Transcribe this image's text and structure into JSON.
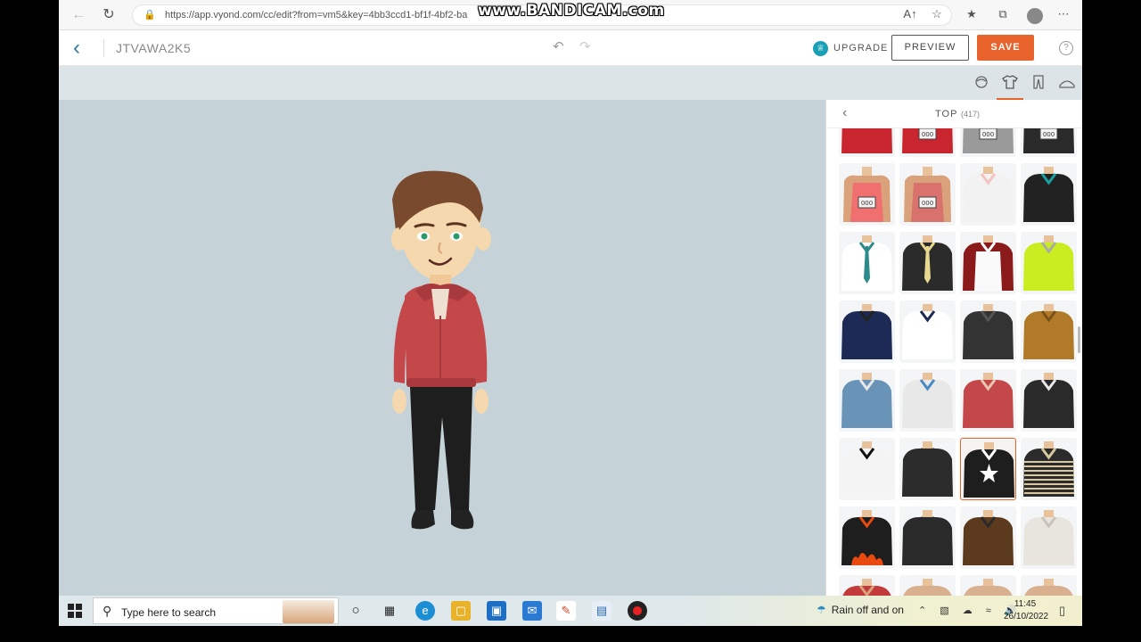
{
  "browser": {
    "url": "https://app.vyond.com/cc/edit?from=vm5&key=4bb3ccd1-bf1f-4bf2-ba",
    "watermark": "www.BANDICAM.com",
    "icons": [
      "back-icon",
      "refresh-icon",
      "lock-icon",
      "read-aloud-icon",
      "favorite-icon",
      "favorites-icon",
      "collections-icon",
      "profile-icon",
      "more-icon"
    ]
  },
  "header": {
    "project_title": "JTVAWA2K5",
    "upgrade_label": "UPGRADE",
    "preview_label": "PREVIEW",
    "save_label": "SAVE",
    "help_label": "?"
  },
  "category_tabs": [
    {
      "name": "head",
      "icon": "head-icon"
    },
    {
      "name": "top",
      "icon": "shirt-icon",
      "active": true
    },
    {
      "name": "bottom",
      "icon": "pants-icon"
    },
    {
      "name": "shoes",
      "icon": "shoe-icon"
    }
  ],
  "panel": {
    "title": "TOP",
    "count": "(417)",
    "selected_index": 22,
    "tiles": [
      {
        "top": "#c8252e",
        "trim": "#222"
      },
      {
        "top": "#c8252e",
        "trim": "#eee",
        "bib": true
      },
      {
        "top": "#9a9a9a",
        "trim": "#ddd",
        "bib": true
      },
      {
        "top": "#2a2a2a",
        "trim": "#ddd",
        "bib": true
      },
      {
        "top": "#f07070",
        "trim": "#d9a27a",
        "bib": true,
        "tank": true
      },
      {
        "top": "#d9716c",
        "trim": "#d9a27a",
        "bib": true,
        "tank": true
      },
      {
        "top": "#f2f2f2",
        "trim": "#f5c2c2"
      },
      {
        "top": "#222",
        "trim": "#1aa0a0"
      },
      {
        "top": "#ffffff",
        "trim": "#2c8a8a",
        "tie": true
      },
      {
        "top": "#2b2b2b",
        "trim": "#e8d890",
        "tie": true
      },
      {
        "top": "#8b1b1b",
        "trim": "#fff",
        "apron": true
      },
      {
        "top": "#c8ee22",
        "trim": "#aaa"
      },
      {
        "top": "#1c2a55",
        "trim": "#222"
      },
      {
        "top": "#ffffff",
        "trim": "#1c2a55"
      },
      {
        "top": "#333",
        "trim": "#555"
      },
      {
        "top": "#b07a28",
        "trim": "#7a5218"
      },
      {
        "top": "#6a93b8",
        "trim": "#e8e8e8"
      },
      {
        "top": "#e8e8e8",
        "trim": "#4a8ac0"
      },
      {
        "top": "#c4474a",
        "trim": "#e8c8b0"
      },
      {
        "top": "#2a2a2a",
        "trim": "#e8e8e8"
      },
      {
        "top": "#f4f4f4",
        "trim": "#111"
      },
      {
        "top": "#2c2c2c",
        "trim": "#2c2c2c"
      },
      {
        "top": "#1e1e1e",
        "trim": "#fff",
        "star": true
      },
      {
        "top": "#2b2b2b",
        "trim": "#d8c8a0",
        "stripes": true
      },
      {
        "top": "#1e1e1e",
        "trim": "#e84a10",
        "flames": true
      },
      {
        "top": "#2a2a2a",
        "trim": "#2a2a2a"
      },
      {
        "top": "#5c3a1e",
        "trim": "#2a2a2a"
      },
      {
        "top": "#e8e4de",
        "trim": "#c9c3b8"
      },
      {
        "top": "#c23a3a",
        "trim": "#d9a27a"
      },
      {
        "top": "#d8b090",
        "trim": "#d8b090"
      },
      {
        "top": "#d8b090",
        "trim": "#d8b090"
      },
      {
        "top": "#d8b090",
        "trim": "#d8b090"
      }
    ]
  },
  "character": {
    "hair": "#7a4a2e",
    "skin": "#f6d8ae",
    "jacket": "#c4474a",
    "pants": "#1e1e1e",
    "shoes": "#1e1e1e",
    "eyes": "#2a9a6a"
  },
  "taskbar": {
    "search_placeholder": "Type here to search",
    "weather_text": "Rain off and on",
    "time": "11:45",
    "date": "26/10/2022",
    "apps": [
      "cortana-icon",
      "task-view-icon",
      "edge-icon",
      "file-explorer-icon",
      "store-icon",
      "mail-icon",
      "paint-icon",
      "notepad-icon",
      "record-icon"
    ]
  },
  "colors": {
    "accent": "#e8632c",
    "brand_teal": "#2f7b9a",
    "stage_bg": "#c5d2d7"
  }
}
